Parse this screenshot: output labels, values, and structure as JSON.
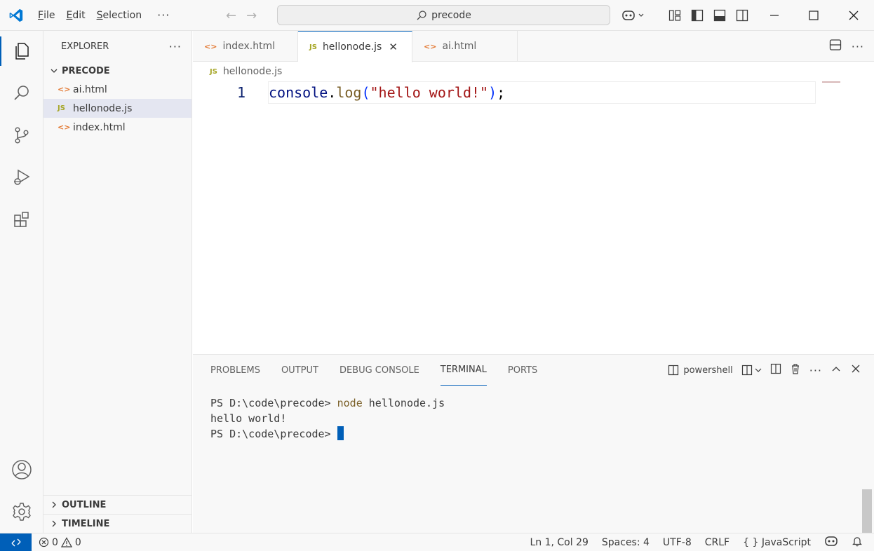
{
  "titlebar": {
    "menu": [
      {
        "pre": "",
        "u": "F",
        "post": "ile"
      },
      {
        "pre": "",
        "u": "E",
        "post": "dit"
      },
      {
        "pre": "",
        "u": "S",
        "post": "election"
      }
    ],
    "more": "···",
    "search_text": "precode"
  },
  "sidebar": {
    "header": "EXPLORER",
    "more": "···",
    "folder": "PRECODE",
    "files": [
      {
        "icon": "<>",
        "name": "ai.html"
      },
      {
        "icon": "JS",
        "name": "hellonode.js"
      },
      {
        "icon": "<>",
        "name": "index.html"
      }
    ],
    "outline": "OUTLINE",
    "timeline": "TIMELINE"
  },
  "editor": {
    "tabs": [
      {
        "icon": "<>",
        "label": "index.html"
      },
      {
        "icon": "JS",
        "label": "hellonode.js",
        "close": "✕"
      },
      {
        "icon": "<>",
        "label": "ai.html"
      }
    ],
    "breadcrumb": {
      "icon": "JS",
      "file": "hellonode.js"
    },
    "line_number": "1",
    "code": {
      "obj": "console",
      "dot": ".",
      "fn": "log",
      "open": "(",
      "str": "\"hello world!\"",
      "close": ")",
      "semi": ";"
    }
  },
  "panel": {
    "tabs": [
      "PROBLEMS",
      "OUTPUT",
      "DEBUG CONSOLE",
      "TERMINAL",
      "PORTS"
    ],
    "shell": "powershell",
    "terminal": {
      "prompt1": "PS D:\\code\\precode> ",
      "cmd": "node",
      "args": " hellonode.js",
      "output": "hello world!",
      "prompt2": "PS D:\\code\\precode> "
    }
  },
  "statusbar": {
    "errors": "0",
    "warnings": "0",
    "position": "Ln 1, Col 29",
    "spaces": "Spaces: 4",
    "encoding": "UTF-8",
    "eol": "CRLF",
    "language_icon": "{ }",
    "language": "JavaScript"
  },
  "colors": {
    "accent": "#005fb8",
    "html_icon": "#e37933",
    "js_icon": "#a6a626"
  }
}
